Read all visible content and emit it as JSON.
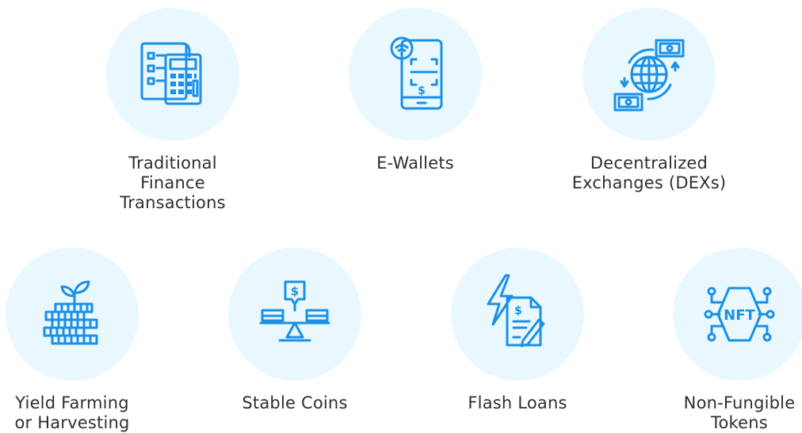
{
  "accent_color": "#1a90e8",
  "circle_color": "#e9f7fe",
  "items": [
    {
      "icon": "calculator-checklist-icon",
      "lines": [
        "Traditional Finance",
        "Transactions"
      ]
    },
    {
      "icon": "mobile-wallet-icon",
      "lines": [
        "E-Wallets",
        ""
      ]
    },
    {
      "icon": "globe-exchange-icon",
      "lines": [
        "Decentralized",
        "Exchanges (DEXs)"
      ]
    },
    {
      "icon": "coin-stack-plant-icon",
      "lines": [
        "Yield Farming",
        "or Harvesting"
      ]
    },
    {
      "icon": "balance-scale-dollar-icon",
      "lines": [
        "Stable Coins",
        ""
      ]
    },
    {
      "icon": "lightning-contract-icon",
      "lines": [
        "Flash Loans",
        ""
      ]
    },
    {
      "icon": "nft-chip-icon",
      "lines": [
        "Non-Fungible",
        "Tokens"
      ]
    }
  ]
}
